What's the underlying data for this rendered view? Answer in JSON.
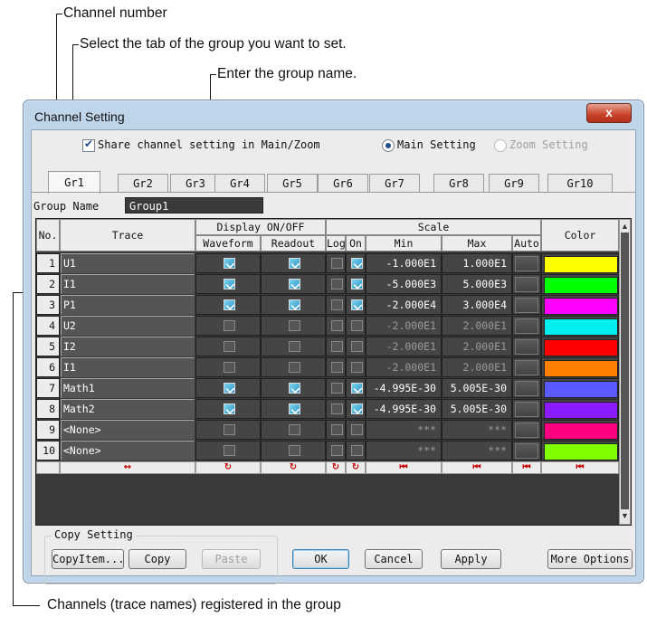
{
  "annotations": {
    "channel_number": "Channel number",
    "select_tab": "Select the tab of the group you want to set.",
    "enter_name": "Enter the group name.",
    "channels_registered": "Channels (trace names) registered in the group"
  },
  "window": {
    "title": "Channel Setting",
    "close_label": "x"
  },
  "options": {
    "share_label": "Share channel setting in Main/Zoom",
    "share_checked": true,
    "main_setting": "Main Setting",
    "zoom_setting": "Zoom Setting"
  },
  "tabs": [
    "Gr1",
    "Gr2",
    "Gr3",
    "Gr4",
    "Gr5",
    "Gr6",
    "Gr7",
    "Gr8",
    "Gr9",
    "Gr10"
  ],
  "group": {
    "label": "Group Name",
    "value": "Group1"
  },
  "table": {
    "headers": {
      "no": "No.",
      "trace": "Trace",
      "display": "Display ON/OFF",
      "waveform": "Waveform",
      "readout": "Readout",
      "scale": "Scale",
      "log": "Log",
      "on": "On",
      "min": "Min",
      "max": "Max",
      "auto": "Auto",
      "color": "Color"
    },
    "rows": [
      {
        "no": "1",
        "trace": "U1",
        "wave": true,
        "read": true,
        "log": false,
        "on": true,
        "min": "-1.000E1",
        "max": "1.000E1",
        "color": "#ffff00",
        "dim": false
      },
      {
        "no": "2",
        "trace": "I1",
        "wave": true,
        "read": true,
        "log": false,
        "on": true,
        "min": "-5.000E3",
        "max": "5.000E3",
        "color": "#00ff00",
        "dim": false
      },
      {
        "no": "3",
        "trace": "P1",
        "wave": true,
        "read": true,
        "log": false,
        "on": true,
        "min": "-2.000E4",
        "max": "3.000E4",
        "color": "#ff00ff",
        "dim": false
      },
      {
        "no": "4",
        "trace": "U2",
        "wave": false,
        "read": false,
        "log": false,
        "on": false,
        "min": "-2.000E1",
        "max": "2.000E1",
        "color": "#00f0f0",
        "dim": true
      },
      {
        "no": "5",
        "trace": "I2",
        "wave": false,
        "read": false,
        "log": false,
        "on": false,
        "min": "-2.000E1",
        "max": "2.000E1",
        "color": "#ff0000",
        "dim": true
      },
      {
        "no": "6",
        "trace": "I1",
        "wave": false,
        "read": false,
        "log": false,
        "on": false,
        "min": "-2.000E1",
        "max": "2.000E1",
        "color": "#ff8000",
        "dim": true
      },
      {
        "no": "7",
        "trace": "Math1",
        "wave": true,
        "read": true,
        "log": false,
        "on": true,
        "min": "-4.995E-30",
        "max": "5.005E-30",
        "color": "#5a5aff",
        "dim": false
      },
      {
        "no": "8",
        "trace": "Math2",
        "wave": true,
        "read": true,
        "log": false,
        "on": true,
        "min": "-4.995E-30",
        "max": "5.005E-30",
        "color": "#8a1cff",
        "dim": false
      },
      {
        "no": "9",
        "trace": "<None>",
        "wave": false,
        "read": false,
        "log": false,
        "on": false,
        "min": "***",
        "max": "***",
        "color": "#ff0080",
        "dim": true
      },
      {
        "no": "10",
        "trace": "<None>",
        "wave": false,
        "read": false,
        "log": false,
        "on": false,
        "min": "***",
        "max": "***",
        "color": "#80ff00",
        "dim": true
      }
    ],
    "footer": {
      "trace": "↔",
      "reset": "↻",
      "first": "⏮"
    }
  },
  "copy": {
    "group_label": "Copy Setting",
    "copy_item": "CopyItem...",
    "copy": "Copy",
    "paste": "Paste"
  },
  "buttons": {
    "ok": "OK",
    "cancel": "Cancel",
    "apply": "Apply",
    "more": "More Options"
  },
  "colors": {
    "window_frame": "#bfd6ea",
    "grid_bg": "#3a3a3a",
    "close_red": "#c7412a"
  }
}
